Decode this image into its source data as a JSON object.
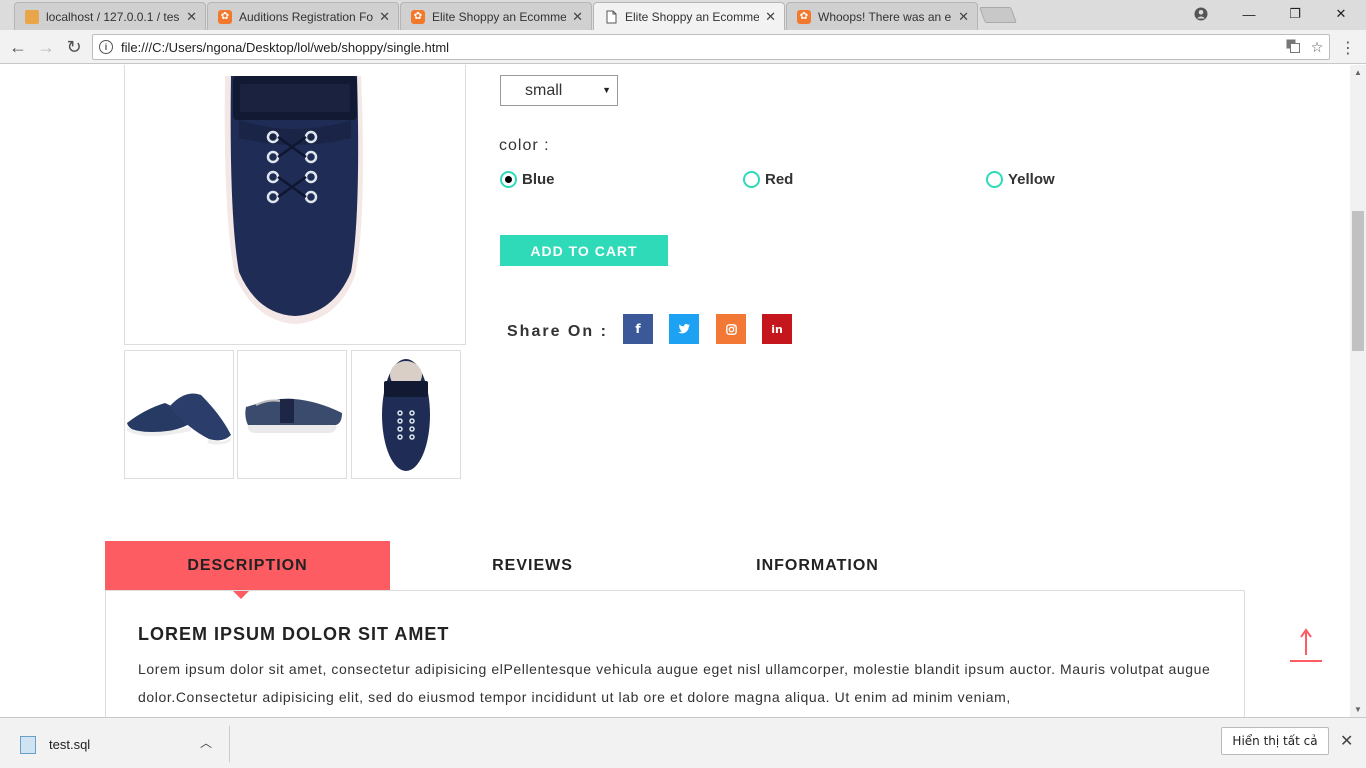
{
  "browser": {
    "tabs": [
      {
        "title": "localhost / 127.0.0.1 / tes",
        "icon": "phpmyadmin-icon"
      },
      {
        "title": "Auditions Registration Fo",
        "icon": "xampp-icon"
      },
      {
        "title": "Elite Shoppy an Ecomme",
        "icon": "xampp-icon"
      },
      {
        "title": "Elite Shoppy an Ecomme",
        "icon": "document-icon",
        "active": true
      },
      {
        "title": "Whoops! There was an e",
        "icon": "xampp-icon"
      }
    ],
    "url": "file:///C:/Users/ngona/Desktop/lol/web/shoppy/single.html"
  },
  "product": {
    "size_selected": "small",
    "color_label": "color :",
    "colors": [
      {
        "label": "Blue",
        "selected": true
      },
      {
        "label": "Red",
        "selected": false
      },
      {
        "label": "Yellow",
        "selected": false
      }
    ],
    "add_to_cart_label": "ADD TO CART",
    "share_label": "Share On :",
    "social": [
      {
        "name": "facebook",
        "glyph": "f",
        "color": "#3b5998"
      },
      {
        "name": "twitter",
        "glyph": "t",
        "color": "#1da1f2"
      },
      {
        "name": "instagram",
        "glyph": "◎",
        "color": "#f37735"
      },
      {
        "name": "linkedin",
        "glyph": "in",
        "color": "#c4161c"
      }
    ]
  },
  "details_tabs": {
    "items": [
      "DESCRIPTION",
      "REVIEWS",
      "INFORMATION"
    ],
    "active": "DESCRIPTION",
    "panel_title": "LOREM IPSUM DOLOR SIT AMET",
    "panel_text": "Lorem ipsum dolor sit amet, consectetur adipisicing elPellentesque vehicula augue eget nisl ullamcorper, molestie blandit ipsum auctor. Mauris volutpat augue dolor.Consectetur adipisicing elit, sed do eiusmod tempor incididunt ut lab ore et dolore magna aliqua. Ut enim ad minim veniam,"
  },
  "download_bar": {
    "file_name": "test.sql",
    "show_all_label": "Hiển thị tất cả"
  },
  "colors": {
    "accent": "#2fdab9",
    "tab_active": "#fd5c63",
    "to_top_arrow": "#fd5c63"
  }
}
